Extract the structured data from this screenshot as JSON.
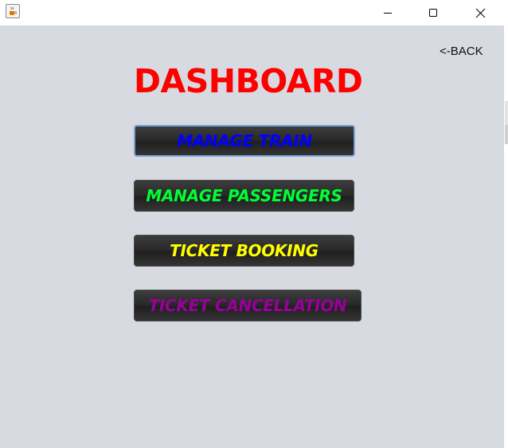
{
  "window": {
    "app_icon": "java-coffee-cup-icon",
    "controls": [
      "minimize-icon",
      "maximize-icon",
      "close-icon"
    ]
  },
  "back_label": "<-BACK",
  "title": "DASHBOARD",
  "buttons": [
    {
      "label": "MANAGE TRAIN",
      "color": "#0000ff"
    },
    {
      "label": "MANAGE PASSENGERS",
      "color": "#00ff33"
    },
    {
      "label": "TICKET BOOKING",
      "color": "#ffff00"
    },
    {
      "label": "TICKET CANCELLATION",
      "color": "#990099"
    }
  ],
  "colors": {
    "title": "#ff0000",
    "background": "#d7dae0",
    "button_face": "#2a2a2a",
    "focus_ring": "#7aa2d6"
  }
}
